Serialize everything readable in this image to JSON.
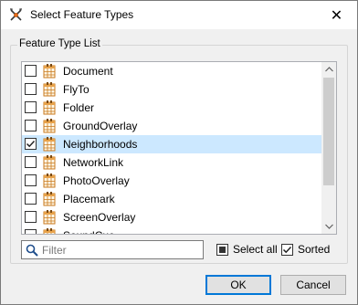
{
  "window": {
    "title": "Select Feature Types",
    "app_icon": "fme-workbench-icon",
    "close_label": "✕"
  },
  "group": {
    "legend": "Feature Type List"
  },
  "feature_types": [
    {
      "label": "Document",
      "checked": false,
      "selected": false
    },
    {
      "label": "FlyTo",
      "checked": false,
      "selected": false
    },
    {
      "label": "Folder",
      "checked": false,
      "selected": false
    },
    {
      "label": "GroundOverlay",
      "checked": false,
      "selected": false
    },
    {
      "label": "Neighborhoods",
      "checked": true,
      "selected": true
    },
    {
      "label": "NetworkLink",
      "checked": false,
      "selected": false
    },
    {
      "label": "PhotoOverlay",
      "checked": false,
      "selected": false
    },
    {
      "label": "Placemark",
      "checked": false,
      "selected": false
    },
    {
      "label": "ScreenOverlay",
      "checked": false,
      "selected": false
    },
    {
      "label": "SoundCue",
      "checked": false,
      "selected": false
    }
  ],
  "filter": {
    "placeholder": "Filter",
    "value": ""
  },
  "options": {
    "select_all": {
      "label": "Select all",
      "state": "indeterminate"
    },
    "sorted": {
      "label": "Sorted",
      "checked": true
    }
  },
  "buttons": {
    "ok": "OK",
    "cancel": "Cancel"
  },
  "colors": {
    "selection": "#cce8ff",
    "accent": "#0078d7"
  }
}
